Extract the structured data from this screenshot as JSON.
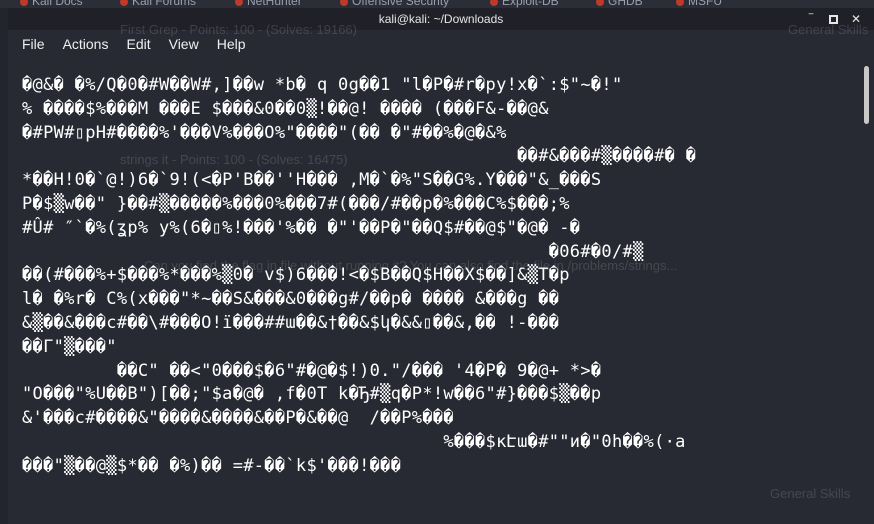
{
  "browser_tabs": [
    "Kali Docs",
    "Kali Forums",
    "NetHunter",
    "Offensive Security",
    "Exploit-DB",
    "GHDB",
    "MSFU"
  ],
  "ghost_text": [
    "First Grep - Points: 100 - (Solves: 19166)",
    "General Skills",
    "strings it - Points: 100 - (Solves: 16475)",
    "Can you find the flag in file without running it? You can also find the file in /problems/strings...",
    "General Skills"
  ],
  "window": {
    "title": "kali@kali: ~/Downloads",
    "minimize_glyph": "‾",
    "close_glyph": "✕"
  },
  "menu": [
    "File",
    "Actions",
    "Edit",
    "View",
    "Help"
  ],
  "terminal_lines": [
    "�@&� �%/Q�0�#W��W#,]��w *b� q 0g��1 \"l�P�#r�py!x�`:$\"~�!\"",
    "% ����$%���M ���E $���&0��0▒!��@! ���� (���F&-��@&",
    "�#PW#▯pH#����%'���V%���O%\"����\"(�� �\"#��%�@�&%",
    "                                               ��#&���#▒����#� �",
    "*��H!0�`@!)6�`9!(<�P'B��''H��� ,M�`�%\"S��G%.Y���\"&_���S",
    "P�$▒w��\" }��#▒�����%���0%���7#(���/#��p�%���C%$���;%",
    "#Û# ″`�%(ʓp% y%(6�▯%!���'%�� �\"'��P�\"��Q$#��@$\"�@� -�",
    "                                                  �06#�0/#▒",
    "��(#���%+$���%*���%▒0� v$)6���!<�$B��Q$H��X$��]&▒T�p",
    "l� �%r� C%(x���\"*~��S&���&0���g#/��p� ���� &���g ��",
    "&▒��&���c#��\\#���O!ï���##ɯ��&†��&$կ�&&▯��&,�� !-���",
    "��Γ\"▒���\"",
    "         ��C\" ��<\"0���$�6\"#�@�$!)0.\"/��� '4�P� 9�@+ *>�",
    "\"O���\"%U��B\")[��;\"$a�@� ,f�0T k�Ђ#▒q�P*!w��6\"#}���$▒��p",
    "&'���c#����&\"����&����&��P�&��@  /��P%���",
    "                                        %���$кԷɯ�#\"\"и�\"0h��%(·a",
    "���\"▒��@▒$*�� �%)�� =#-��`k$'���!���"
  ]
}
